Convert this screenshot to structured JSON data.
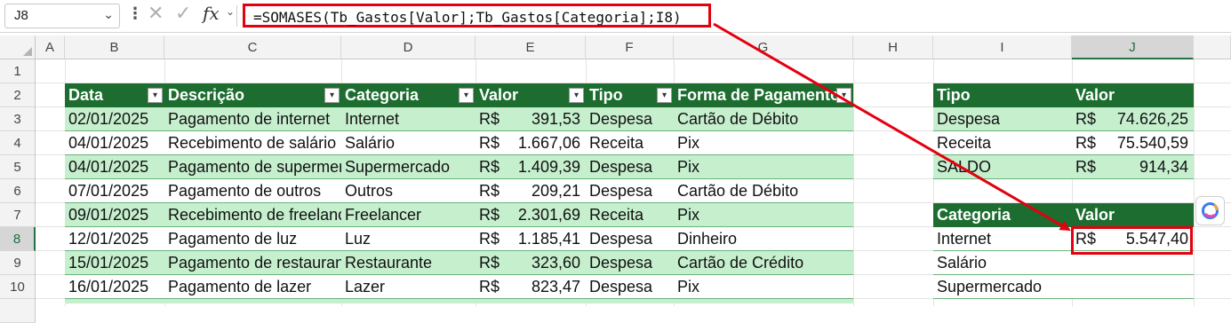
{
  "name_box": "J8",
  "formula_bar": {
    "value": "=SOMASES(Tb_Gastos[Valor];Tb_Gastos[Categoria];I8)",
    "icons": [
      "more-icon",
      "cancel-icon",
      "enter-icon",
      "insert-function-icon"
    ],
    "fx_label": "fx"
  },
  "columns": [
    "A",
    "B",
    "C",
    "D",
    "E",
    "F",
    "G",
    "H",
    "I",
    "J"
  ],
  "rows": [
    "1",
    "2",
    "3",
    "4",
    "5",
    "6",
    "7",
    "8",
    "9",
    "10"
  ],
  "selected_cell": {
    "column": "J",
    "row": "8"
  },
  "main_table": {
    "headers": [
      "Data",
      "Descrição",
      "Categoria",
      "Valor",
      "Tipo",
      "Forma de Pagamento"
    ],
    "rows": [
      [
        "02/01/2025",
        "Pagamento de internet",
        "Internet",
        "R$",
        "391,53",
        "Despesa",
        "Cartão de Débito"
      ],
      [
        "04/01/2025",
        "Recebimento de salário",
        "Salário",
        "R$",
        "1.667,06",
        "Receita",
        "Pix"
      ],
      [
        "04/01/2025",
        "Pagamento de supermercado",
        "Supermercado",
        "R$",
        "1.409,39",
        "Despesa",
        "Pix"
      ],
      [
        "07/01/2025",
        "Pagamento de outros",
        "Outros",
        "R$",
        "209,21",
        "Despesa",
        "Cartão de Débito"
      ],
      [
        "09/01/2025",
        "Recebimento de freelancer",
        "Freelancer",
        "R$",
        "2.301,69",
        "Receita",
        "Pix"
      ],
      [
        "12/01/2025",
        "Pagamento de luz",
        "Luz",
        "R$",
        "1.185,41",
        "Despesa",
        "Dinheiro"
      ],
      [
        "15/01/2025",
        "Pagamento de restaurante",
        "Restaurante",
        "R$",
        "323,60",
        "Despesa",
        "Cartão de Crédito"
      ],
      [
        "16/01/2025",
        "Pagamento de lazer",
        "Lazer",
        "R$",
        "823,47",
        "Despesa",
        "Pix"
      ]
    ]
  },
  "summary_table": {
    "headers": [
      "Tipo",
      "Valor"
    ],
    "rows": [
      [
        "Despesa",
        "R$",
        "74.626,25"
      ],
      [
        "Receita",
        "R$",
        "75.540,59"
      ],
      [
        "SALDO",
        "R$",
        "914,34"
      ]
    ]
  },
  "category_table": {
    "headers": [
      "Categoria",
      "Valor"
    ],
    "rows": [
      [
        "Internet",
        "R$",
        "5.547,40"
      ],
      [
        "Salário",
        "",
        ""
      ],
      [
        "Supermercado",
        "",
        ""
      ]
    ]
  },
  "colors": {
    "header_green": "#1d6d30",
    "band_green": "#c6efce",
    "highlight_red": "#e3000f"
  }
}
